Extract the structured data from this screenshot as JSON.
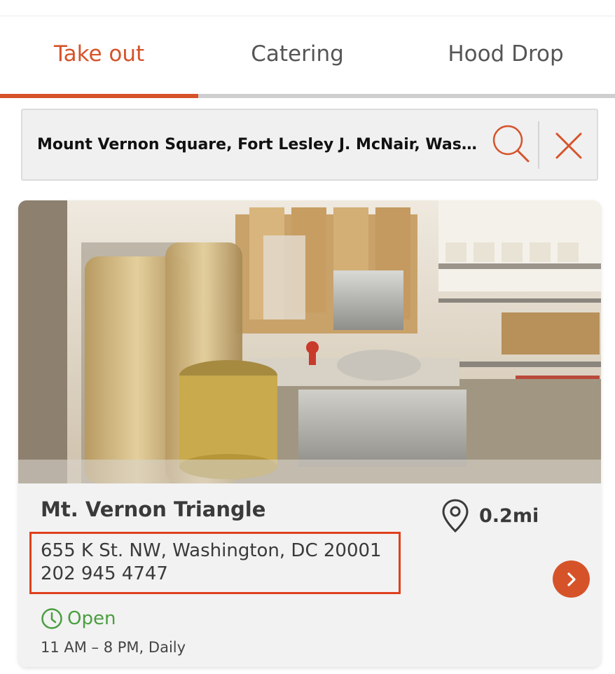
{
  "tabs": [
    {
      "label": "Take out",
      "active": true
    },
    {
      "label": "Catering",
      "active": false
    },
    {
      "label": "Hood Drop",
      "active": false
    }
  ],
  "search": {
    "value": "Mount Vernon Square, Fort Lesley J. McNair, Washingt...",
    "search_icon": "search-icon",
    "clear_icon": "close-icon"
  },
  "location": {
    "name": "Mt. Vernon Triangle",
    "distance": "0.2mi",
    "address": "655 K St. NW, Washington, DC 20001",
    "phone": "202 945 4747",
    "status": "Open",
    "hours": "11 AM – 8 PM, Daily",
    "pin_icon": "map-pin-icon",
    "clock_icon": "clock-icon",
    "go_icon": "chevron-right-icon"
  },
  "colors": {
    "accent": "#d6532a",
    "open_status": "#4a9e3f",
    "highlight_box": "#e0401d",
    "tab_inactive": "#555555"
  }
}
